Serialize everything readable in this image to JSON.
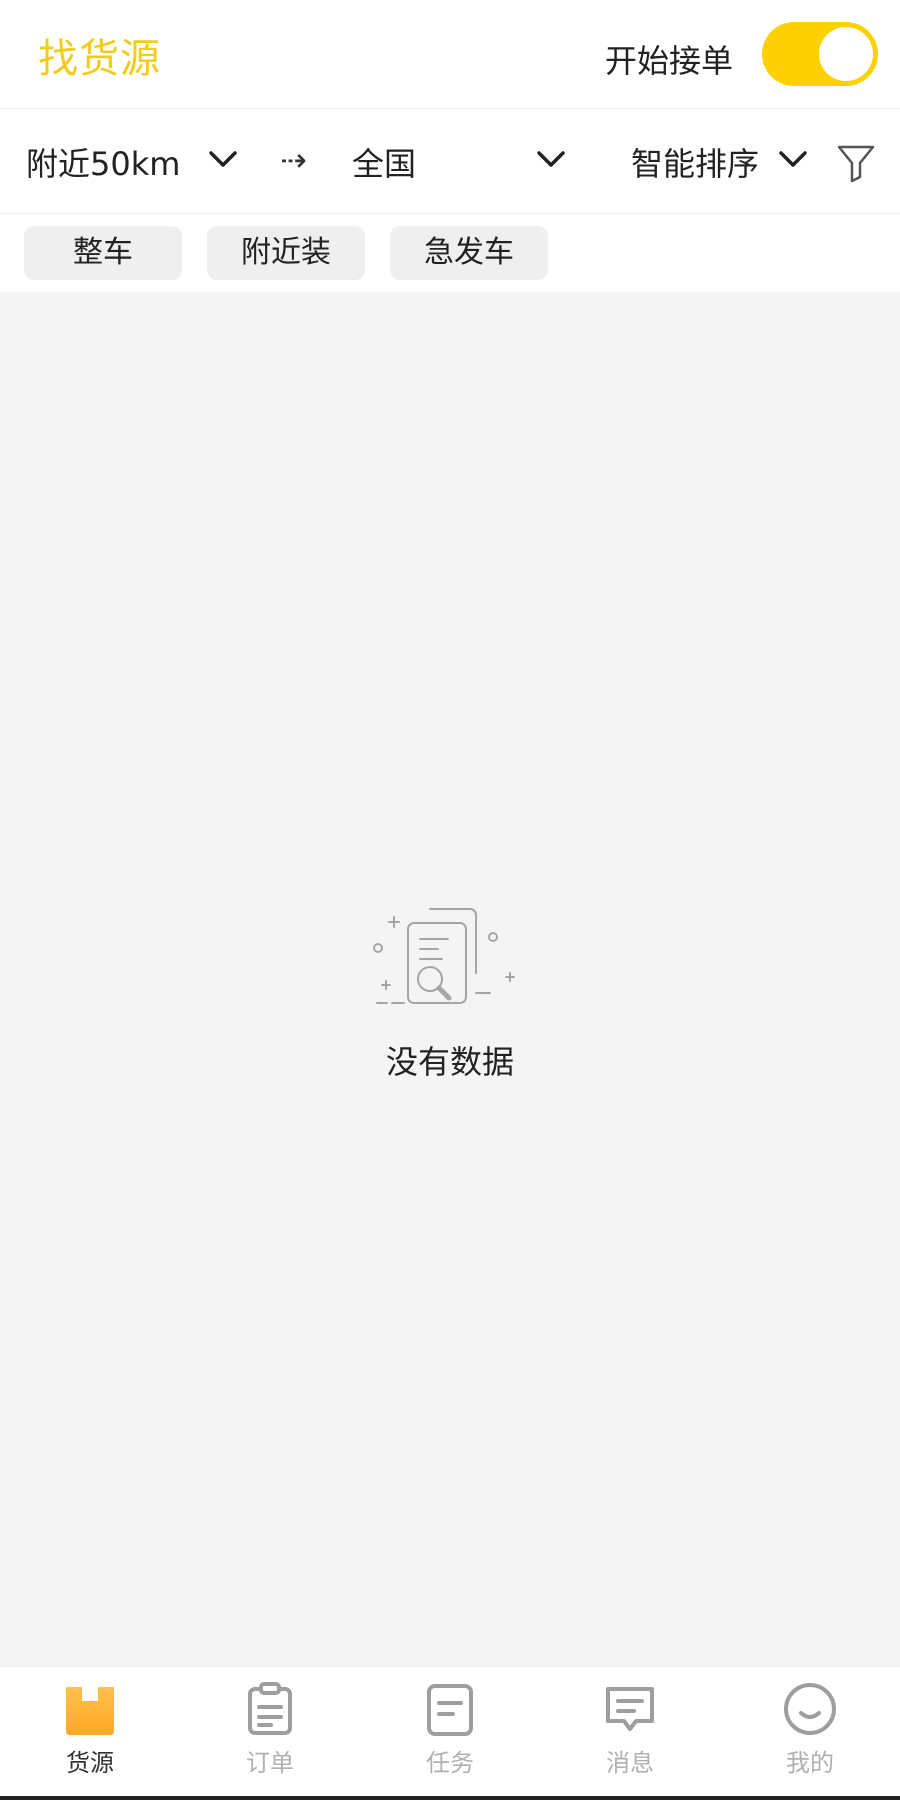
{
  "header": {
    "title": "找货源",
    "toggle_label": "开始接单",
    "toggle_on": true
  },
  "filters": {
    "origin": "附近50km",
    "arrow": "⇢",
    "destination": "全国",
    "sort": "智能排序",
    "filter_icon": "funnel-icon"
  },
  "tags": [
    "整车",
    "附近装",
    "急发车"
  ],
  "empty": {
    "icon": "empty-document-search-icon",
    "text": "没有数据"
  },
  "tabbar": {
    "items": [
      {
        "label": "货源",
        "icon": "cargo-icon",
        "active": true
      },
      {
        "label": "订单",
        "icon": "clipboard-icon",
        "active": false
      },
      {
        "label": "任务",
        "icon": "task-document-icon",
        "active": false
      },
      {
        "label": "消息",
        "icon": "message-icon",
        "active": false
      },
      {
        "label": "我的",
        "icon": "smiley-icon",
        "active": false
      }
    ]
  },
  "colors": {
    "accent": "#fdd000",
    "title": "#f2cc17",
    "active_tab_icon": "#ffb534",
    "inactive": "#b0b0b0"
  }
}
